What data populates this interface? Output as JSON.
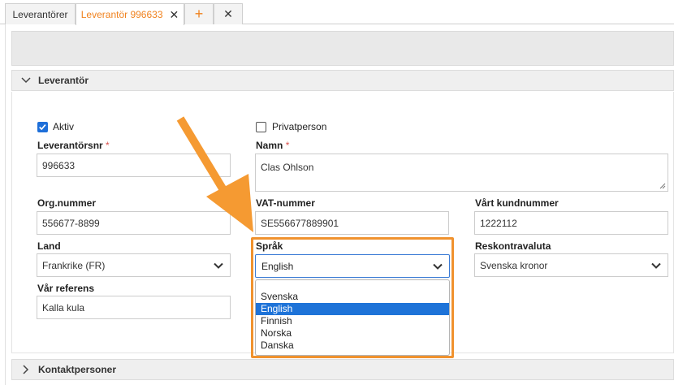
{
  "tabs": [
    {
      "label": "Leverantörer"
    },
    {
      "label": "Leverantör 996633"
    }
  ],
  "section_leverantor": {
    "title": "Leverantör"
  },
  "section_kontakt": {
    "title": "Kontaktpersoner"
  },
  "fields": {
    "aktiv": {
      "label": "Aktiv",
      "checked": true
    },
    "privatperson": {
      "label": "Privatperson",
      "checked": false
    },
    "leverantorsnr": {
      "label": "Leverantörsnr",
      "required": "*",
      "value": "996633"
    },
    "namn": {
      "label": "Namn",
      "required": "*",
      "value": "Clas Ohlson"
    },
    "orgnummer": {
      "label": "Org.nummer",
      "value": "556677-8899"
    },
    "vatnummer": {
      "label": "VAT-nummer",
      "value": "SE556677889901"
    },
    "kundnummer": {
      "label": "Vårt kundnummer",
      "value": "1222112"
    },
    "land": {
      "label": "Land",
      "value": "Frankrike (FR)"
    },
    "sprak": {
      "label": "Språk",
      "value": "English"
    },
    "reskontravaluta": {
      "label": "Reskontravaluta",
      "value": "Svenska kronor"
    },
    "var_referens": {
      "label": "Vår referens",
      "value": "Kalla kula"
    }
  },
  "dropdown": {
    "options": [
      "Svenska",
      "English",
      "Finnish",
      "Norska",
      "Danska"
    ],
    "selected": "English"
  },
  "colors": {
    "accent": "#f0821e",
    "highlight": "#f0922e",
    "select_blue": "#1e73d8"
  }
}
